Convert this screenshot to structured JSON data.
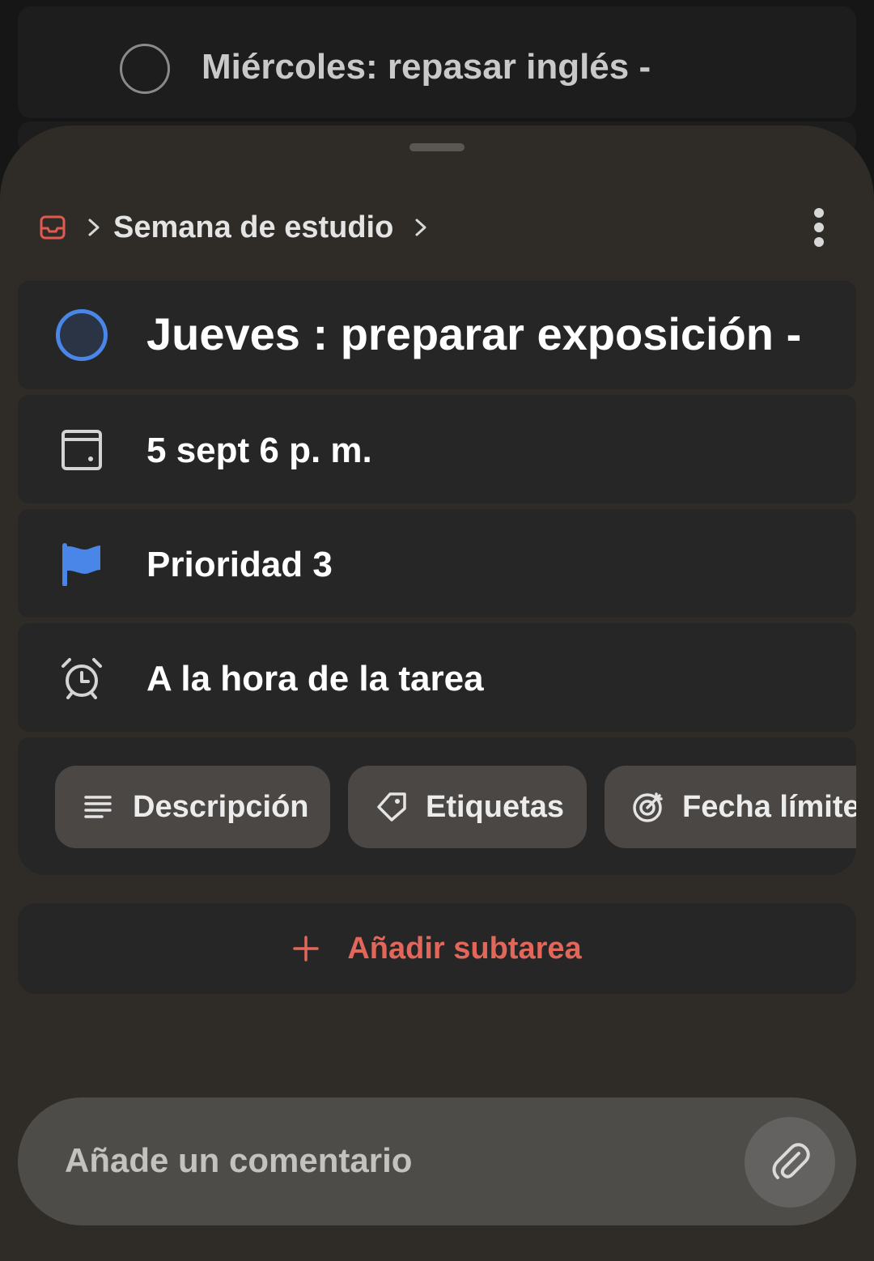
{
  "background_task": {
    "title": "Miércoles: repasar inglés -"
  },
  "sheet": {
    "breadcrumb": {
      "project": "Semana de estudio"
    },
    "task": {
      "title": "Jueves : preparar exposición -",
      "date": "5 sept 6 p. m.",
      "priority": "Prioridad 3",
      "reminder": "A la hora de la tarea"
    },
    "chips": {
      "description": "Descripción",
      "labels": "Etiquetas",
      "deadline": "Fecha límite"
    },
    "add_subtask": "Añadir subtarea",
    "comment_placeholder": "Añade un comentario"
  },
  "colors": {
    "accent_red": "#e2675a",
    "check_blue": "#4a86e8",
    "priority_flag": "#4a86e8"
  },
  "icons": {
    "inbox": "inbox-icon",
    "date": "calendar-icon",
    "priority": "flag-icon",
    "reminder": "alarm-clock-icon",
    "description": "lines-icon",
    "labels": "tag-icon",
    "deadline": "target-icon",
    "add": "plus-icon",
    "attach": "paperclip-icon",
    "more": "more-vertical-icon"
  }
}
